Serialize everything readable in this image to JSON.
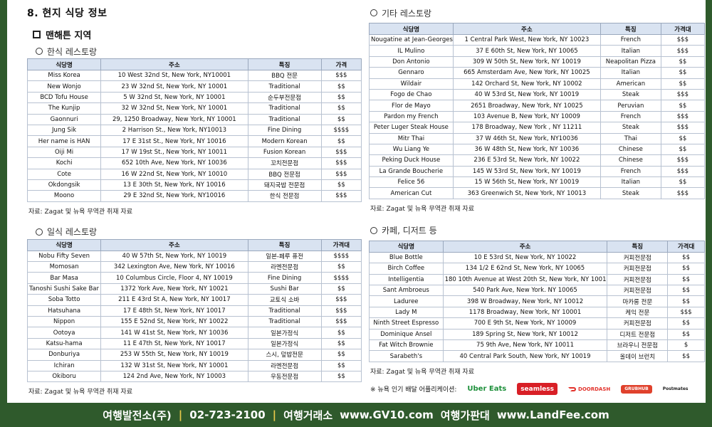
{
  "section_title": "8. 현지 식당 정보",
  "area_title": "맨해튼 지역",
  "korean": {
    "title": "한식 레스토랑",
    "headers": [
      "식당명",
      "주소",
      "특징",
      "가격"
    ],
    "rows": [
      [
        "Miss Korea",
        "10 West 32nd St, New York, NY10001",
        "BBQ 전문",
        "$$$"
      ],
      [
        "New Wonjo",
        "23 W 32nd St, New York, NY 10001",
        "Traditional",
        "$$"
      ],
      [
        "BCD Tofu House",
        "5 W 32nd St, New York, NY 10001",
        "순두부전문점",
        "$$"
      ],
      [
        "The Kunjip",
        "32 W 32nd St, New York, NY 10001",
        "Traditional",
        "$$"
      ],
      [
        "Gaonnuri",
        "29, 1250 Broadway, New York, NY 10001",
        "Traditional",
        "$$"
      ],
      [
        "Jung Sik",
        "2 Harrison St., New York, NY10013",
        "Fine Dining",
        "$$$$"
      ],
      [
        "Her name is HAN",
        "17 E 31st St., New York, NY 10016",
        "Modern Korean",
        "$$"
      ],
      [
        "Oiji Mi",
        "17 W 19st St., New York, NY 10011",
        "Fusion Korean",
        "$$$"
      ],
      [
        "Kochi",
        "652 10th Ave, New York, NY 10036",
        "꼬치전문점",
        "$$$"
      ],
      [
        "Cote",
        "16 W 22nd St, New York, NY 10010",
        "BBQ 전문점",
        "$$$"
      ],
      [
        "Okdongsik",
        "13 E 30th St, New York, NY 10016",
        "돼지국밥 전문점",
        "$$"
      ],
      [
        "Moono",
        "29 E 32nd St, New York, NY10016",
        "한식 전문점",
        "$$$"
      ]
    ],
    "note": "자료: Zagat 및 뉴욕 무역관 취재 자료"
  },
  "japanese": {
    "title": "일식 레스토랑",
    "headers": [
      "식당명",
      "주소",
      "특징",
      "가격대"
    ],
    "rows": [
      [
        "Nobu Fifty Seven",
        "40 W 57th St, New York, NY 10019",
        "일본-페루 퓨전",
        "$$$$"
      ],
      [
        "Momosan",
        "342 Lexington Ave, New York, NY 10016",
        "라멘전문점",
        "$$"
      ],
      [
        "Bar Masa",
        "10 Columbus Circle, Floor 4, NY 10019",
        "Fine Dining",
        "$$$$"
      ],
      [
        "Tanoshi Sushi Sake Bar",
        "1372 York Ave, New York, NY 10021",
        "Sushi Bar",
        "$$"
      ],
      [
        "Soba Totto",
        "211 E 43rd St A, New York, NY 10017",
        "교토식 소바",
        "$$$"
      ],
      [
        "Hatsuhana",
        "17 E 48th St, New York, NY 10017",
        "Traditional",
        "$$$"
      ],
      [
        "Nippon",
        "155 E 52nd St, New York, NY 10022",
        "Traditional",
        "$$$"
      ],
      [
        "Ootoya",
        "141 W 41st St, New York, NY 10036",
        "일본가정식",
        "$$"
      ],
      [
        "Katsu-hama",
        "11 E 47th St, New York, NY 10017",
        "일본가정식",
        "$$"
      ],
      [
        "Donburiya",
        "253 W 55th St, New York, NY 10019",
        "스시, 덮밥전문",
        "$$"
      ],
      [
        "Ichiran",
        "132 W 31st St, New York, NY 10001",
        "라멘전문점",
        "$$"
      ],
      [
        "Okiboru",
        "124 2nd Ave, New York, NY 10003",
        "우동전문점",
        "$$"
      ]
    ],
    "note": "자료: Zagat 및 뉴욕 무역관 취재 자료"
  },
  "other": {
    "title": "기타 레스토랑",
    "headers": [
      "식당명",
      "주소",
      "특징",
      "가격대"
    ],
    "rows": [
      [
        "Nougatine at Jean-Georges",
        "1 Central Park West, New York, NY 10023",
        "French",
        "$$$"
      ],
      [
        "IL Mulino",
        "37 E 60th St, New York, NY 10065",
        "Italian",
        "$$$"
      ],
      [
        "Don Antonio",
        "309 W 50th St, New York, NY 10019",
        "Neapolitan Pizza",
        "$$"
      ],
      [
        "Gennaro",
        "665 Amsterdam Ave, New York, NY 10025",
        "Italian",
        "$$"
      ],
      [
        "Wildair",
        "142 Orchard St, New York, NY 10002",
        "American",
        "$$"
      ],
      [
        "Fogo de Chao",
        "40 W 53rd St, New York, NY 10019",
        "Steak",
        "$$$"
      ],
      [
        "Flor de Mayo",
        "2651 Broadway, New York, NY 10025",
        "Peruvian",
        "$$"
      ],
      [
        "Pardon my French",
        "103 Avenue B, New York, NY 10009",
        "French",
        "$$$"
      ],
      [
        "Peter Luger Steak House",
        "178 Broadway, New York , NY 11211",
        "Steak",
        "$$$"
      ],
      [
        "Mitr Thai",
        "37 W 46th St, New York, NY10036",
        "Thai",
        "$$"
      ],
      [
        "Wu Liang Ye",
        "36 W 48th St, New York, NY 10036",
        "Chinese",
        "$$"
      ],
      [
        "Peking Duck House",
        "236 E 53rd St, New York, NY 10022",
        "Chinese",
        "$$$"
      ],
      [
        "La Grande Boucherie",
        "145 W 53rd St, New York, NY 10019",
        "French",
        "$$$"
      ],
      [
        "Felice 56",
        "15 W 56th St, New York, NY 10019",
        "Italian",
        "$$"
      ],
      [
        "American Cut",
        "363 Greenwich St, New York, NY 10013",
        "Steak",
        "$$$"
      ]
    ],
    "note": "자료: Zagat 및 뉴욕 무역관 취재 자료"
  },
  "cafe": {
    "title": "카페, 디저트 등",
    "headers": [
      "식당명",
      "주소",
      "특징",
      "가격대"
    ],
    "rows": [
      [
        "Blue Bottle",
        "10 E 53rd St, New York, NY 10022",
        "커피전문점",
        "$$"
      ],
      [
        "Birch Coffee",
        "134 1/2 E 62nd St, New York, NY 10065",
        "커피전문점",
        "$$"
      ],
      [
        "Intelligentia",
        "180 10th Avenue at West 20th St, New York, NY 10011",
        "커피전문점",
        "$$"
      ],
      [
        "Sant Ambroeus",
        "540 Park Ave, New York. NY 10065",
        "커피전문점",
        "$$"
      ],
      [
        "Laduree",
        "398 W Broadway, New York, NY 10012",
        "마카롱 전문",
        "$$"
      ],
      [
        "Lady M",
        "1178 Broadway, New York, NY 10001",
        "케익 전문",
        "$$$"
      ],
      [
        "Ninth Street Espresso",
        "700 E 9th St, New York, NY 10009",
        "커피전문점",
        "$$"
      ],
      [
        "Dominique Ansel",
        "189 Spring St, New York, NY 10012",
        "디저트 전문점",
        "$$"
      ],
      [
        "Fat Witch Brownie",
        "75 9th Ave, New York, NY 10011",
        "브라우니 전문점",
        "$"
      ],
      [
        "Sarabeth's",
        "40 Central Park South, New York, NY 10019",
        "올데이 브런치",
        "$$"
      ]
    ],
    "note": "자료: Zagat 및 뉴욕 무역관 취재 자료"
  },
  "delivery": {
    "label": "※ 뉴욕 인기 배달 어플리케이션:",
    "apps": [
      "Uber Eats",
      "seamless",
      "DOORDASH",
      "GRUBHUB",
      "Postmates"
    ]
  },
  "footer": {
    "company": "여행발전소(주)",
    "phone": "02-723-2100",
    "tagline1": "여행거래소",
    "url1": "www.GV10.com",
    "tagline2": "여행가판대",
    "url2": "www.LandFee.com"
  }
}
